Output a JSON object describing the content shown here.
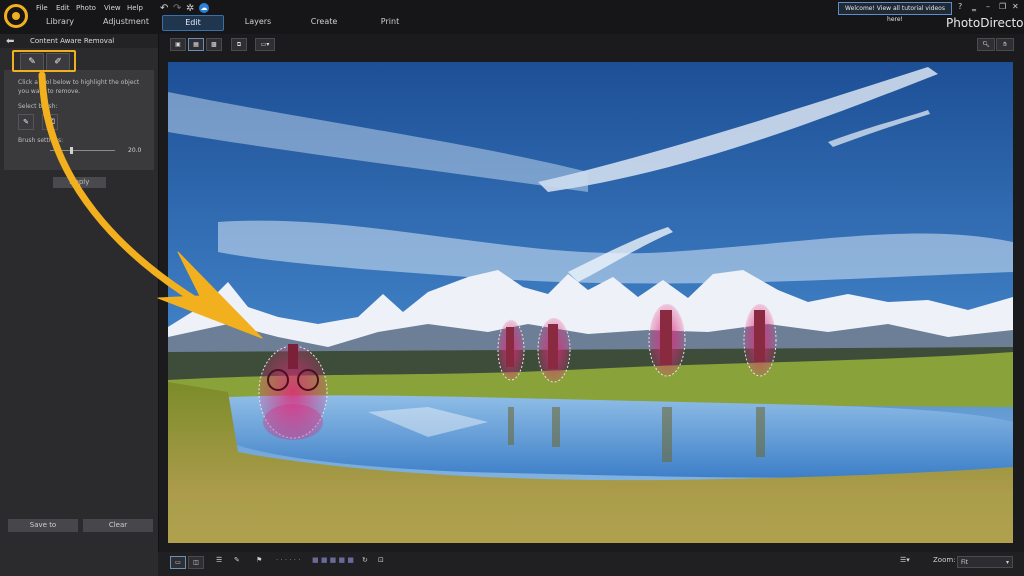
{
  "menu": [
    "File",
    "Edit",
    "Photo",
    "View",
    "Help"
  ],
  "tabs": [
    "Library",
    "Adjustment",
    "Edit",
    "Layers",
    "Create",
    "Print"
  ],
  "active_tab": "Edit",
  "welcome_text": "Welcome! View all tutorial videos here!",
  "brand": "PhotoDirector",
  "panel": {
    "title": "Content Aware Removal",
    "instruction": "Click a tool below to highlight the object you want to remove.",
    "select_brush": "Select brush:",
    "brush_settings": "Brush settings:",
    "brush_value": "20.0",
    "apply": "Apply",
    "save_to": "Save to",
    "clear": "Clear"
  },
  "zoom": {
    "label": "Zoom:",
    "value": "Fit"
  },
  "colors": {
    "accent": "#f2b01e",
    "tab_active": "#20364f",
    "highlight": "#e0287a"
  }
}
